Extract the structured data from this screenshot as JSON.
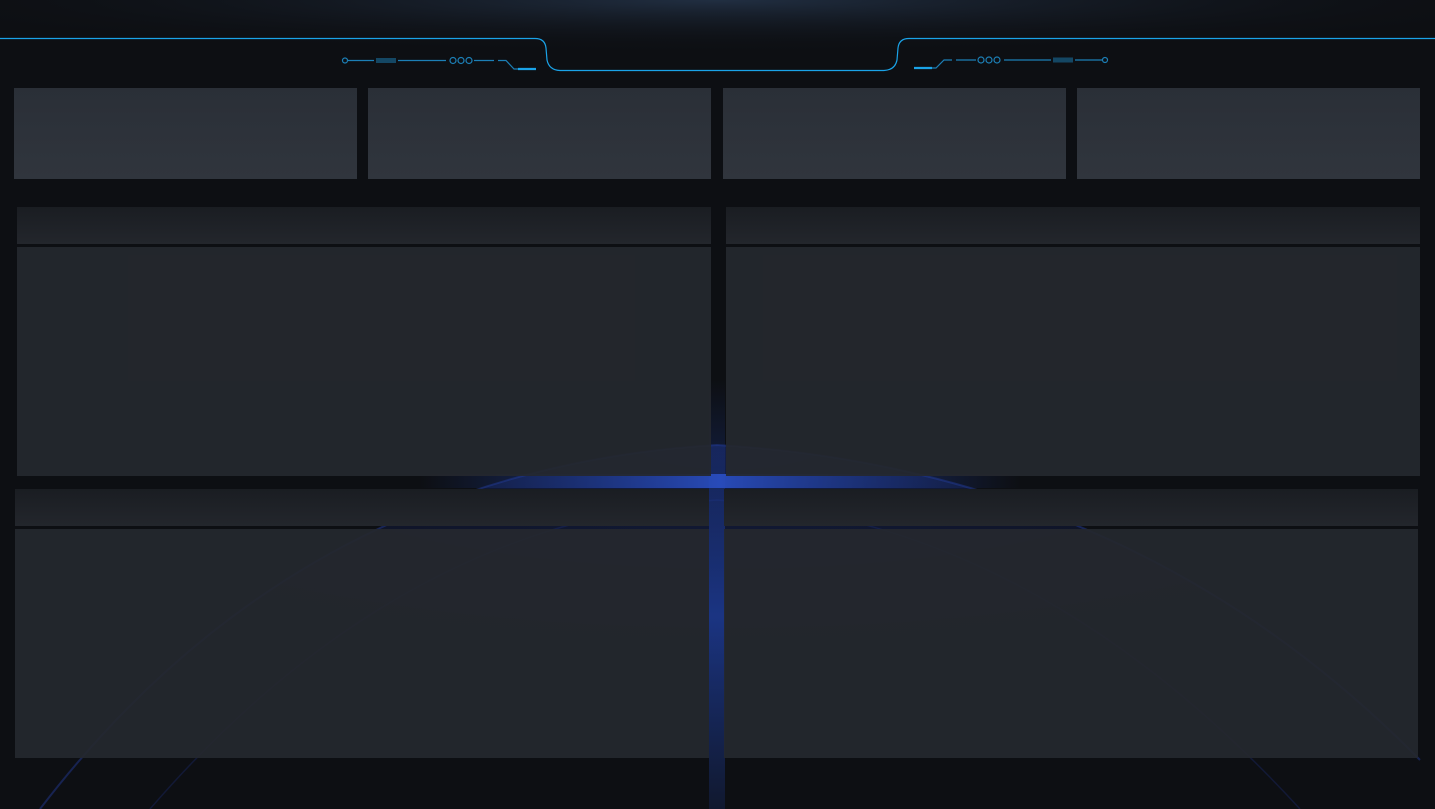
{
  "header": {
    "title": "",
    "accent_color": "#1aa3e8",
    "ornament_color": "#1c7fb6"
  },
  "kpi_cards": [
    {
      "label": "",
      "value": ""
    },
    {
      "label": "",
      "value": ""
    },
    {
      "label": "",
      "value": ""
    },
    {
      "label": "",
      "value": ""
    }
  ],
  "panels": [
    {
      "title": ""
    },
    {
      "title": ""
    },
    {
      "title": ""
    },
    {
      "title": ""
    }
  ],
  "colors": {
    "page_background": "#0d0f13",
    "card_background": "#2e333b",
    "panel_header": "#1f2227",
    "panel_body": "#23262b",
    "globe_glow": "#1b3d9e"
  }
}
